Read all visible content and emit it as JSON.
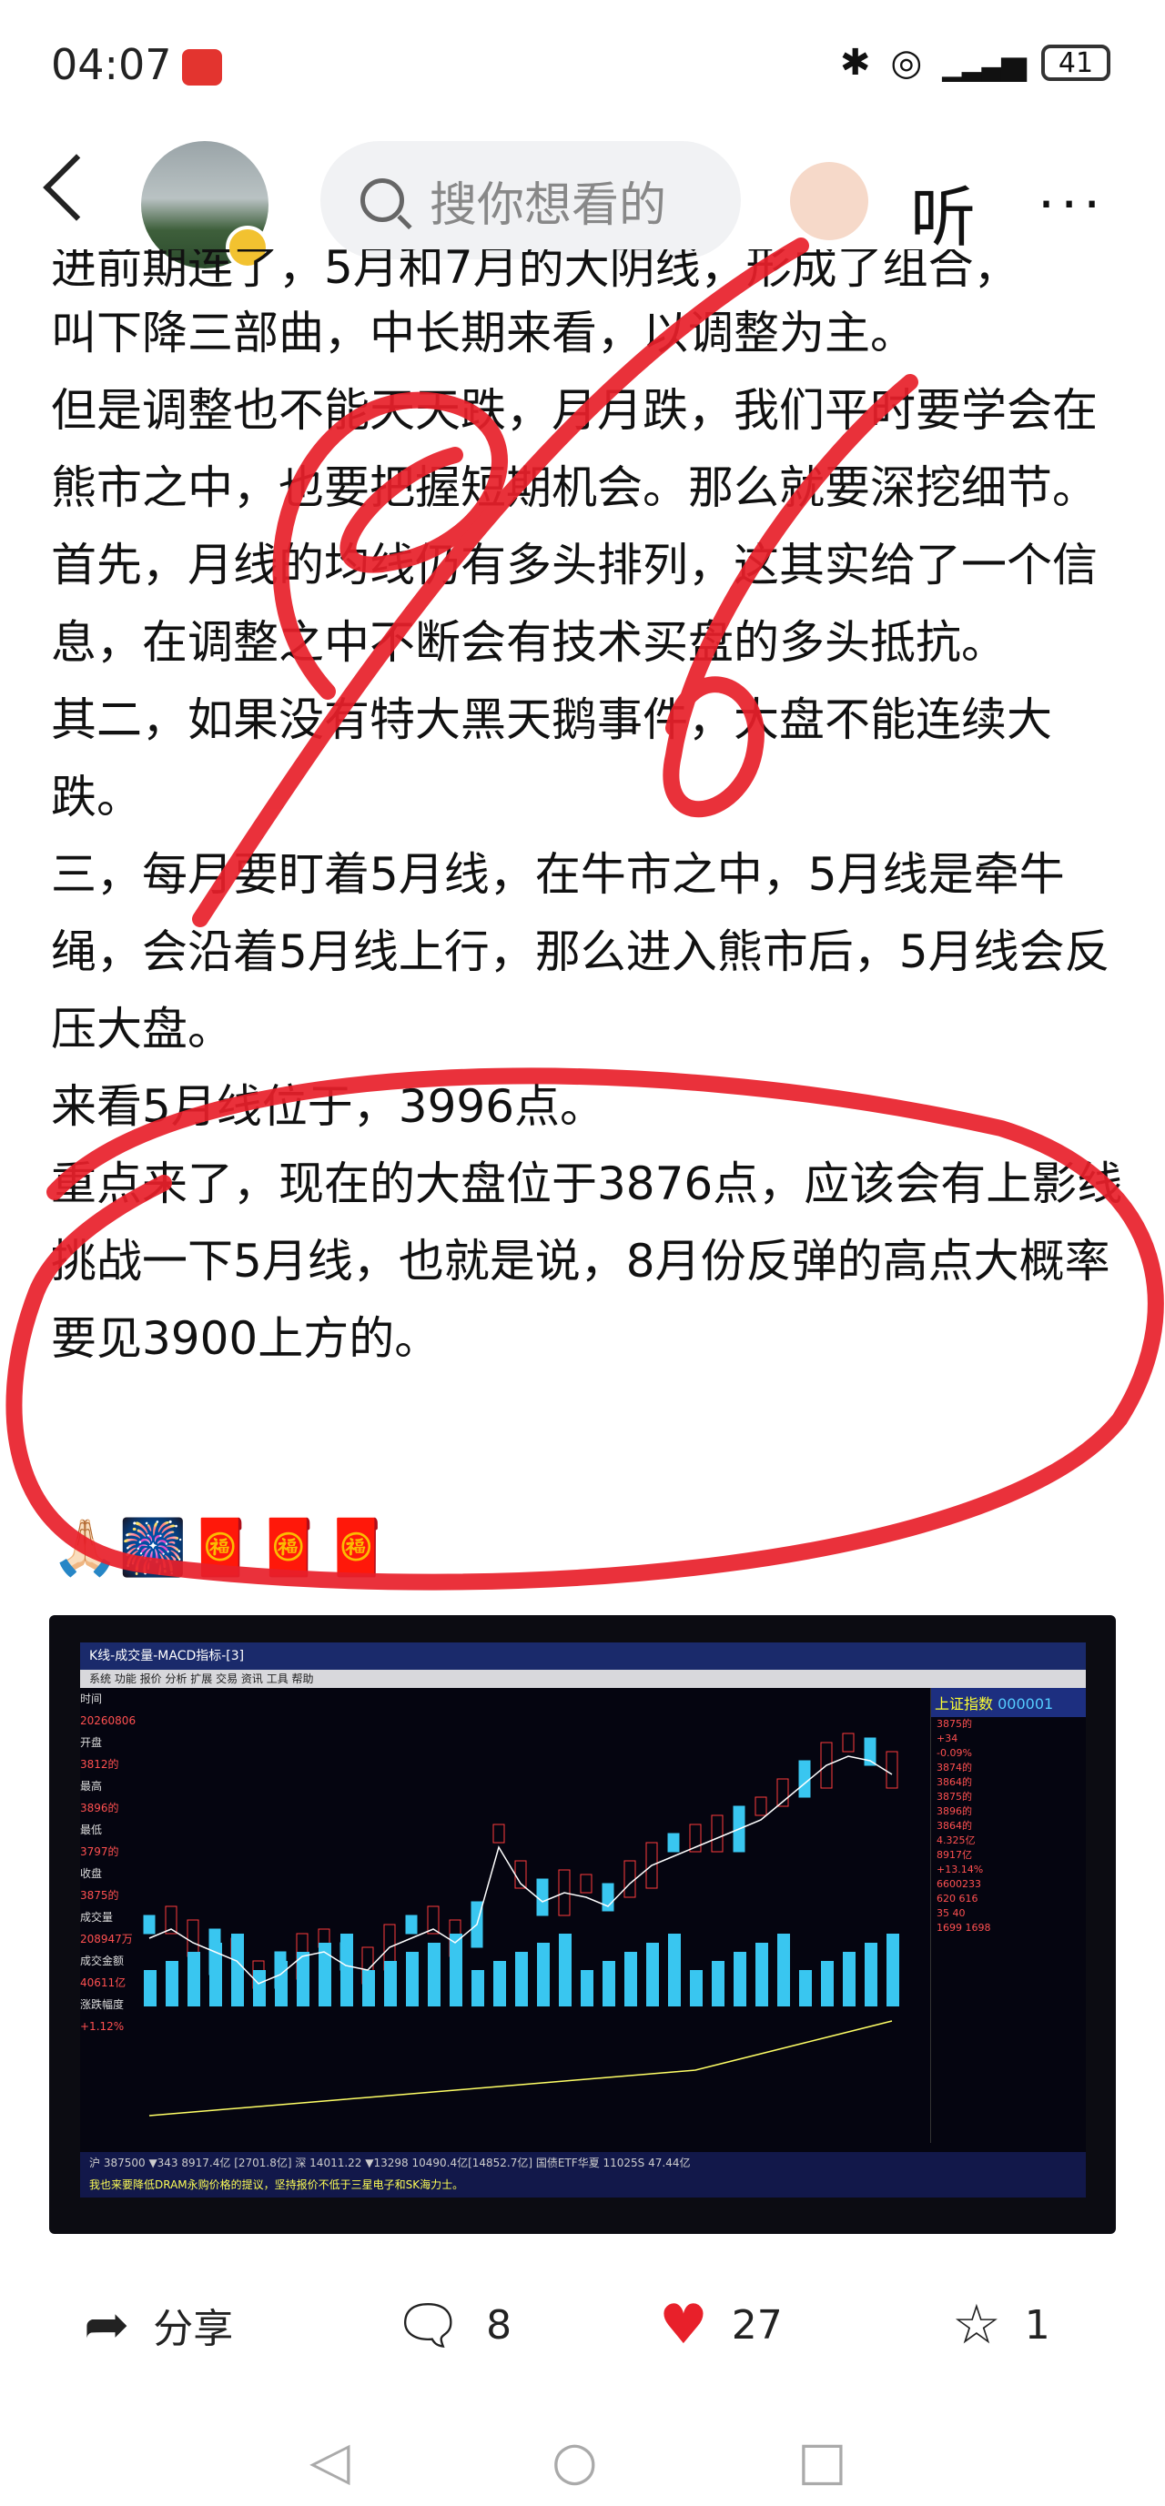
{
  "status_bar": {
    "time": "04:07",
    "signal": "1",
    "battery": "41"
  },
  "header": {
    "search_placeholder": "搜你想看的",
    "listen_label": "听",
    "more_label": "···"
  },
  "article": {
    "paragraphs": [
      "进前期连了，5月和7月的大阴线，形成了组合，",
      "叫下降三部曲，中长期来看，以调整为主。",
      "但是调整也不能天天跌，月月跌，我们平时要学会在熊市之中，也要把握短期机会。那么就要深挖细节。",
      "首先，月线的均线仍有多头排列，这其实给了一个信息，在调整之中不断会有技术买盘的多头抵抗。",
      "其二，如果没有特大黑天鹅事件，大盘不能连续大跌。",
      "三，每月要盯着5月线，在牛市之中，5月线是牵牛绳，会沿着5月线上行，那么进入熊市后，5月线会反压大盘。",
      "来看5月线位于，3996点。",
      "重点来了，现在的大盘位于3876点，应该会有上影线挑战一下5月线，也就是说，8月份反弹的高点大概率要见3900上方的。"
    ],
    "emojis": "🙏🏻🎆🧧🧧🧧"
  },
  "photo": {
    "window_title": "K线-成交量-MACD指标-[3]",
    "tabs": "系统 功能 报价 分析 扩展 交易 资讯 工具 帮助",
    "left_labels": [
      "时间",
      "20260806",
      "开盘",
      "3812的",
      "最高",
      "3896的",
      "最低",
      "3797的",
      "收盘",
      "3875的",
      "成交量",
      "208947万",
      "成交金额",
      "40611亿",
      "涨跌幅度",
      "+1.12%"
    ],
    "index_name": "上证指数",
    "index_code": "000001",
    "right_values": [
      "3875的",
      "+34",
      "-0.09%",
      "3874的",
      "3864的",
      "3875的",
      "3896的",
      "3864的",
      "4.325亿",
      "8917亿",
      "+13.14%",
      "6600233",
      "620 616",
      "35 40",
      "1699 1698"
    ],
    "bottom_text": "沪 387500 ▼343 8917.4亿 [2701.8亿] 深 14011.22 ▼13298 10490.4亿[14852.7亿] 国债ETF华夏 11025S 47.44亿",
    "ticker_text": "我也来要降低DRAM永购价格的提议，坚持报价不低于三星电子和SK海力士。"
  },
  "actions": {
    "share": "分享",
    "comments": "8",
    "likes": "27",
    "favorites": "1"
  },
  "colors": {
    "ink": "#e8202a",
    "like": "#e8202a",
    "screen_bg": "#050510",
    "candle_up": "#ff3b3b",
    "candle_down": "#39c6f0"
  }
}
